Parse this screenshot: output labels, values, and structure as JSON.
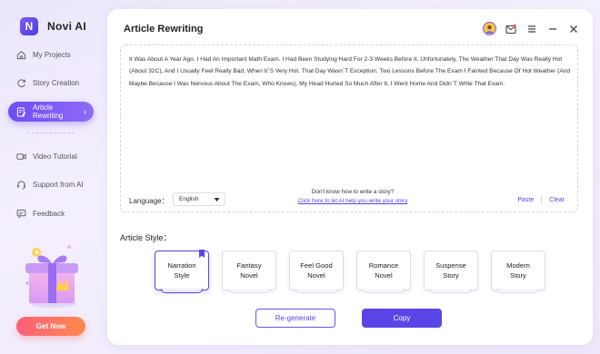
{
  "brand": {
    "name": "Novi AI",
    "logo_letter": "N"
  },
  "sidebar": {
    "items": [
      {
        "label": "My Projects",
        "icon": "home-icon"
      },
      {
        "label": "Story Creation",
        "icon": "refresh-icon"
      },
      {
        "label": "Article Rewriting",
        "icon": "document-edit-icon",
        "active": true
      },
      {
        "label": "Video Tutorial",
        "icon": "video-icon"
      },
      {
        "label": "Support from AI",
        "icon": "headset-icon"
      },
      {
        "label": "Feedback",
        "icon": "feedback-icon"
      }
    ],
    "promo_button": "Get Now"
  },
  "header": {
    "title": "Article Rewriting",
    "icons": [
      "avatar",
      "mail-icon",
      "menu-icon",
      "minimize-icon",
      "close-icon"
    ]
  },
  "editor": {
    "text": "It Was About A Year Ago. I Had An Important Math Exam. I Had Been Studying Hard For 2-3 Weeks Before It. Unfortunately, The Weather That Day Was Really Hot (About 32C), And I Usually Feel Really Bad, When It`S Very Hot. That Day Wasn`T Exception. Two Lessons Before The Exam I Fainted Because Of Hot Weather (And Maybe Because I Was Nervous About The Exam, Who Knows), My Head Hurted So Much After It, I Went Home And Didn`T Write That Exam.",
    "language_label": "Language：",
    "language_value": "English",
    "help_question": "Don't know how to write a story?",
    "help_link": "Click here to let AI help you write your story",
    "paste_label": "Paste",
    "clear_label": "Clear"
  },
  "article_style": {
    "label": "Article Style：",
    "options": [
      {
        "line1": "Narration",
        "line2": "Style",
        "selected": true
      },
      {
        "line1": "Fantasy",
        "line2": "Novel"
      },
      {
        "line1": "Feel Good",
        "line2": "Novel"
      },
      {
        "line1": "Romance",
        "line2": "Novel"
      },
      {
        "line1": "Suspense",
        "line2": "Story"
      },
      {
        "line1": "Modern",
        "line2": "Story"
      }
    ]
  },
  "actions": {
    "regenerate": "Re-generate",
    "copy": "Copy"
  },
  "colors": {
    "accent": "#5a45e6",
    "promo_start": "#ff5f7a",
    "promo_end": "#ff8a4c"
  }
}
